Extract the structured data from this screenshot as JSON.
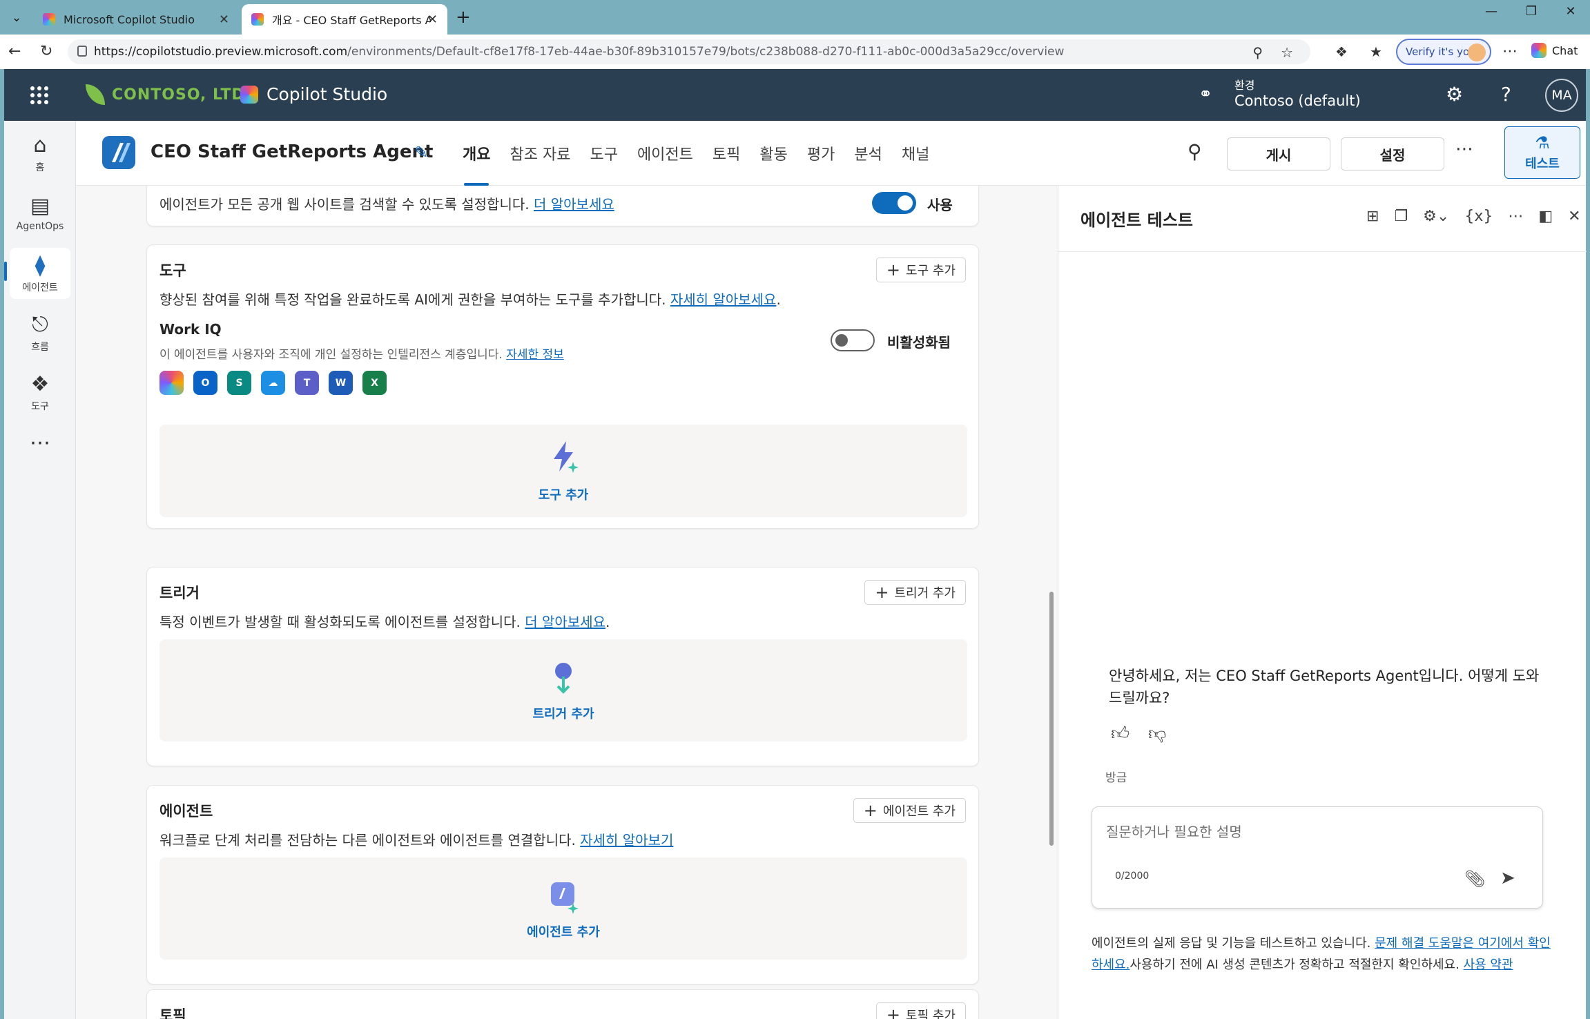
{
  "browser": {
    "tabs": [
      {
        "title": "Microsoft Copilot Studio"
      },
      {
        "title": "개요 - CEO Staff GetReports Agent"
      }
    ],
    "url_host": "https://copilotstudio.preview.microsoft.com",
    "url_path": "/environments/Default-cf8e17f8-17eb-44ae-b30f-89b310157e79/bots/c238b088-d270-f111-ab0c-000d3a5a29cc/overview",
    "verify_label": "Verify it's you",
    "chat_label": "Chat"
  },
  "appheader": {
    "org_name": "CONTOSO, LTD.",
    "product_name": "Copilot Studio",
    "env_label": "환경",
    "env_name": "Contoso (default)",
    "avatar_initials": "MA"
  },
  "rail": {
    "items": [
      {
        "label": "홈",
        "icon": "home-icon"
      },
      {
        "label": "AgentOps",
        "icon": "agentops-icon"
      },
      {
        "label": "에이전트",
        "icon": "agent-icon"
      },
      {
        "label": "흐름",
        "icon": "flow-icon"
      },
      {
        "label": "도구",
        "icon": "tools-icon"
      },
      {
        "label": "",
        "icon": "more-icon"
      }
    ]
  },
  "agentbar": {
    "agent_name": "CEO Staff GetReports Agent",
    "tabs": [
      {
        "label": "개요"
      },
      {
        "label": "참조 자료"
      },
      {
        "label": "도구"
      },
      {
        "label": "에이전트"
      },
      {
        "label": "토픽"
      },
      {
        "label": "활동"
      },
      {
        "label": "평가"
      },
      {
        "label": "분석"
      },
      {
        "label": "채널"
      }
    ],
    "publish_label": "게시",
    "settings_label": "설정",
    "test_label": "테스트"
  },
  "main": {
    "websearch": {
      "desc": "에이전트가 모든 공개 웹 사이트를 검색할 수 있도록 설정합니다.",
      "link": "더 알아보세요",
      "toggle_label": "사용",
      "toggle_on": true
    },
    "tools": {
      "title": "도구",
      "add_label": "도구 추가",
      "desc": "향상된 참여를 위해 특정 작업을 완료하도록 AI에게 권한을 부여하는 도구를 추가합니다.",
      "link": "자세히 알아보세요",
      "workiq_title": "Work IQ",
      "workiq_desc": "이 에이전트를 사용자와 조직에 개인 설정하는 인텔리전스 계층입니다.",
      "workiq_link": "자세한 정보",
      "workiq_toggle_label": "비활성화됨",
      "workiq_toggle_on": false,
      "empty_label": "도구 추가"
    },
    "triggers": {
      "title": "트리거",
      "add_label": "트리거 추가",
      "desc": "특정 이벤트가 발생할 때 활성화되도록 에이전트를 설정합니다.",
      "link": "더 알아보세요",
      "empty_label": "트리거 추가"
    },
    "agents": {
      "title": "에이전트",
      "add_label": "에이전트 추가",
      "desc": "워크플로 단계 처리를 전담하는 다른 에이전트와 에이전트를 연결합니다.",
      "link": "자세히 알아보기",
      "empty_label": "에이전트 추가"
    },
    "topics": {
      "title": "토픽",
      "add_label": "토픽 추가"
    }
  },
  "panel": {
    "title": "에이전트 테스트",
    "greeting": "안녕하세요, 저는 CEO Staff GetReports Agent입니다. 어떻게 도와 드릴까요?",
    "timestamp": "방금",
    "input_placeholder": "질문하거나 필요한 설명",
    "counter": "0/2000",
    "disclaimer_text1": "에이전트의 실제 응답 및 기능을 테스트하고 있습니다.",
    "disclaimer_link1": "문제 해결 도움말은 여기에서 확인하세요.",
    "disclaimer_text2": "사용하기 전에 AI 생성 콘텐츠가 정확하고 적절한지 확인하세요.",
    "disclaimer_link2": "사용 약관"
  }
}
